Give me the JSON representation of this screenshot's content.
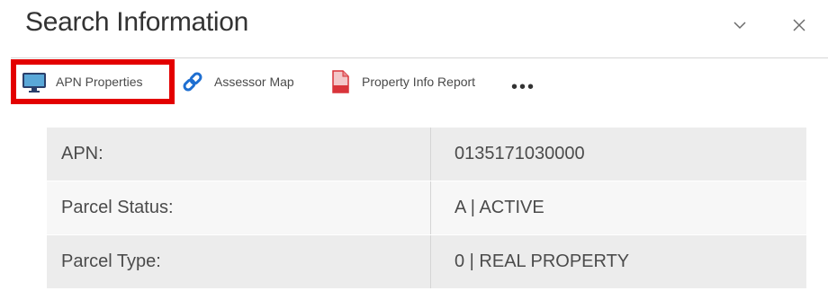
{
  "header": {
    "title": "Search Information",
    "collapse_icon": "chevron-down-icon",
    "close_icon": "close-icon"
  },
  "toolbar": {
    "items": [
      {
        "label": "APN Properties",
        "icon": "monitor-icon",
        "highlighted": true
      },
      {
        "label": "Assessor Map",
        "icon": "link-icon"
      },
      {
        "label": "Property Info Report",
        "icon": "pdf-icon"
      }
    ],
    "more_label": "•••"
  },
  "colors": {
    "highlight_border": "#e30000",
    "link_blue": "#1f6fd1",
    "pdf_red": "#d9343a",
    "row_dark": "#ececec",
    "row_light": "#f7f7f7"
  },
  "table": {
    "rows": [
      {
        "label": "APN:",
        "value": "0135171030000"
      },
      {
        "label": "Parcel Status:",
        "value": "A | ACTIVE"
      },
      {
        "label": "Parcel Type:",
        "value": "0 | REAL PROPERTY"
      }
    ]
  }
}
